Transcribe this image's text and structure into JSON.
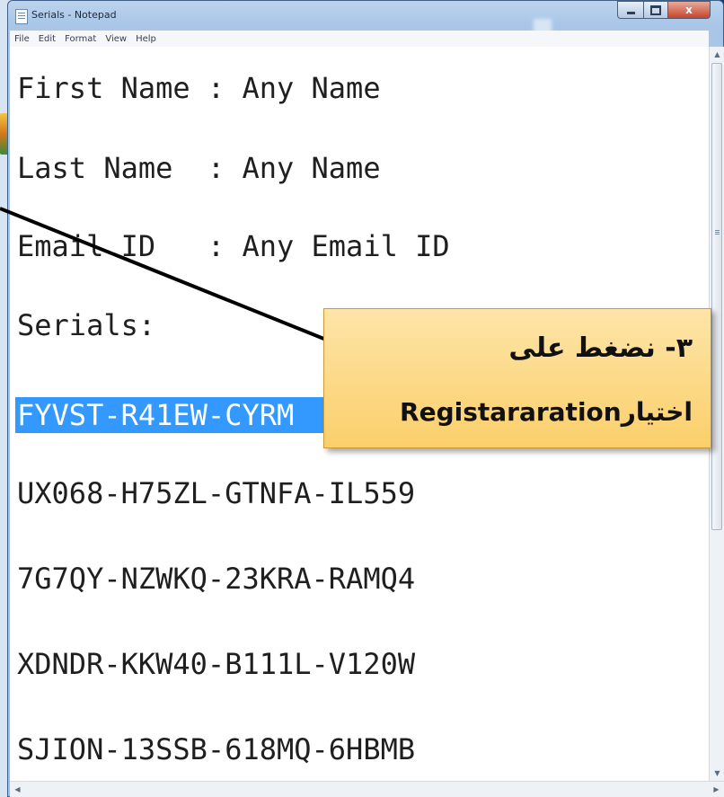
{
  "window": {
    "title": "Serials - Notepad",
    "controls": {
      "minimize_icon": "minimize-icon",
      "maximize_icon": "maximize-icon",
      "close_label": "x"
    }
  },
  "menubar": {
    "items": [
      {
        "label": "File"
      },
      {
        "label": "Edit"
      },
      {
        "label": "Format"
      },
      {
        "label": "View"
      },
      {
        "label": "Help"
      }
    ]
  },
  "document": {
    "lines": [
      "First Name : Any Name",
      "Last Name  : Any Name",
      "Email ID   : Any Email ID",
      "Serials:",
      "FYVST-R41EW-CYRM",
      "UX068-H75ZL-GTNFA-IL559",
      "7G7QY-NZWKQ-23KRA-RAMQ4",
      "XDNDR-KKW40-B111L-V120W",
      "SJION-13SSB-618MQ-6HBMB"
    ],
    "selected_line_index": 4
  },
  "annotation": {
    "line1": "٣- نضغط على",
    "line2_latin": "Registararation",
    "line2_arabic": "اختيار"
  },
  "colors": {
    "selection": "#3399ff",
    "callout_top": "#fde5a8",
    "callout_bottom": "#fbcf6b"
  }
}
